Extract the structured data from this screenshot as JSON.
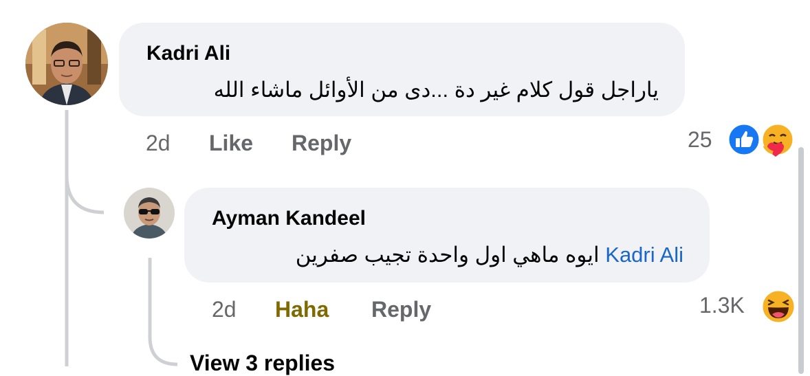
{
  "comments": [
    {
      "author": "Kadri Ali",
      "text": "ياراجل قول كلام غير دة ...دى من الأوائل ماشاء الله",
      "time": "2d",
      "like_label": "Like",
      "reply_label": "Reply",
      "reaction_count": "25",
      "reactions": [
        "like-icon",
        "care-icon"
      ]
    },
    {
      "author": "Ayman Kandeel",
      "mention": "Kadri Ali",
      "text": "ايوه ماهي اول واحدة تجيب صفرين",
      "time": "2d",
      "like_label": "Haha",
      "reply_label": "Reply",
      "reaction_count": "1.3K",
      "reactions": [
        "haha-icon"
      ],
      "view_replies": "View 3 replies"
    }
  ],
  "colors": {
    "bubble": "#f0f2f5",
    "mention": "#1a66c9",
    "haha_active": "#7f6a00",
    "muted": "#65676b",
    "like_blue": "#1877f2"
  }
}
